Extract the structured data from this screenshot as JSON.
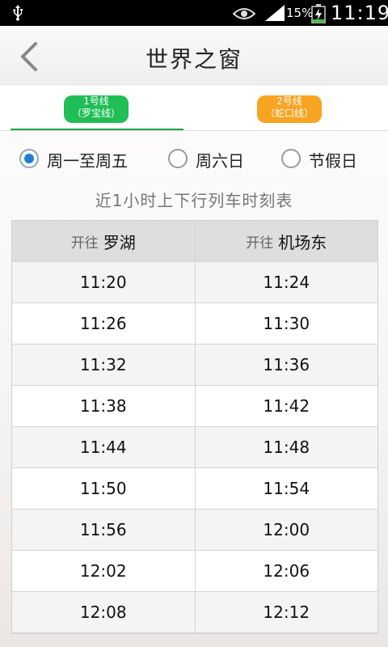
{
  "status_bar": {
    "battery_percent": "15%",
    "time": "11:19",
    "icons": [
      "usb-icon",
      "eye-icon",
      "signal-icon",
      "battery-charging-icon"
    ]
  },
  "header": {
    "title": "世界之窗",
    "back_icon": "chevron-left-icon"
  },
  "tabs": [
    {
      "line": "1号线",
      "name": "（罗宝线）",
      "color": "#1fbf56",
      "selected": true
    },
    {
      "line": "2号线",
      "name": "（蛇口线）",
      "color": "#f7a420",
      "selected": false
    }
  ],
  "day_options": [
    {
      "label": "周一至周五",
      "selected": true
    },
    {
      "label": "周六日",
      "selected": false
    },
    {
      "label": "节假日",
      "selected": false
    }
  ],
  "subtitle": "近1小时上下行列车时刻表",
  "timetable": {
    "columns": [
      {
        "prefix": "开往",
        "destination": "罗湖"
      },
      {
        "prefix": "开往",
        "destination": "机场东"
      }
    ],
    "rows": [
      [
        "11:20",
        "11:24"
      ],
      [
        "11:26",
        "11:30"
      ],
      [
        "11:32",
        "11:36"
      ],
      [
        "11:38",
        "11:42"
      ],
      [
        "11:44",
        "11:48"
      ],
      [
        "11:50",
        "11:54"
      ],
      [
        "11:56",
        "12:00"
      ],
      [
        "12:02",
        "12:06"
      ],
      [
        "12:08",
        "12:12"
      ]
    ]
  }
}
